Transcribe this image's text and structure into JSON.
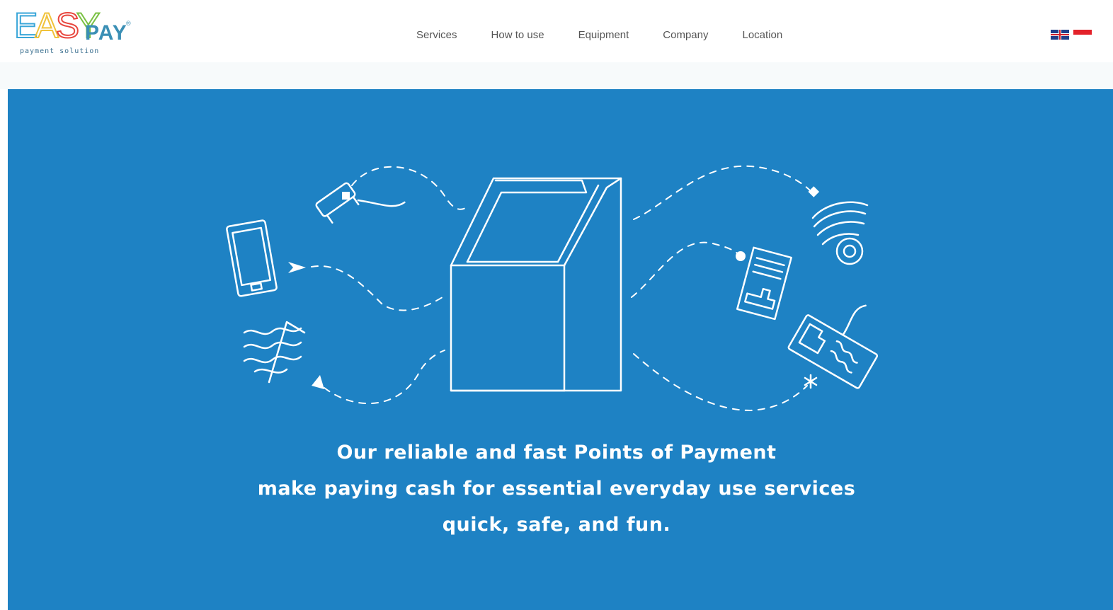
{
  "header": {
    "logo": {
      "letters": [
        {
          "char": "E",
          "color": "#39a6d8"
        },
        {
          "char": "A",
          "color": "#f0c23b"
        },
        {
          "char": "S",
          "color": "#e8473f"
        },
        {
          "char": "Y",
          "color": "#7ac143"
        }
      ],
      "pay": "PAY",
      "tagline": "payment solution",
      "tm": "®"
    },
    "nav": [
      {
        "label": "Services",
        "name": "nav-services"
      },
      {
        "label": "How to use",
        "name": "nav-how-to-use"
      },
      {
        "label": "Equipment",
        "name": "nav-equipment"
      },
      {
        "label": "Company",
        "name": "nav-company"
      },
      {
        "label": "Location",
        "name": "nav-location"
      }
    ],
    "languages": [
      "uk-flag-icon",
      "indonesia-flag-icon"
    ]
  },
  "hero": {
    "background": "#1e82c4",
    "line1": "Our reliable and fast Points of Payment",
    "line2": "make paying cash for essential everyday use services",
    "line3": "quick, safe, and fun.",
    "icons": [
      "phone-handset-icon",
      "mobile-phone-icon",
      "water-tap-icon",
      "payment-kiosk-icon",
      "wifi-signal-icon",
      "bill-document-icon",
      "keyboard-icon"
    ]
  },
  "colors": {
    "hero": "#1e82c4",
    "nav_text": "#555555",
    "logo_blue": "#3a8fb5"
  }
}
